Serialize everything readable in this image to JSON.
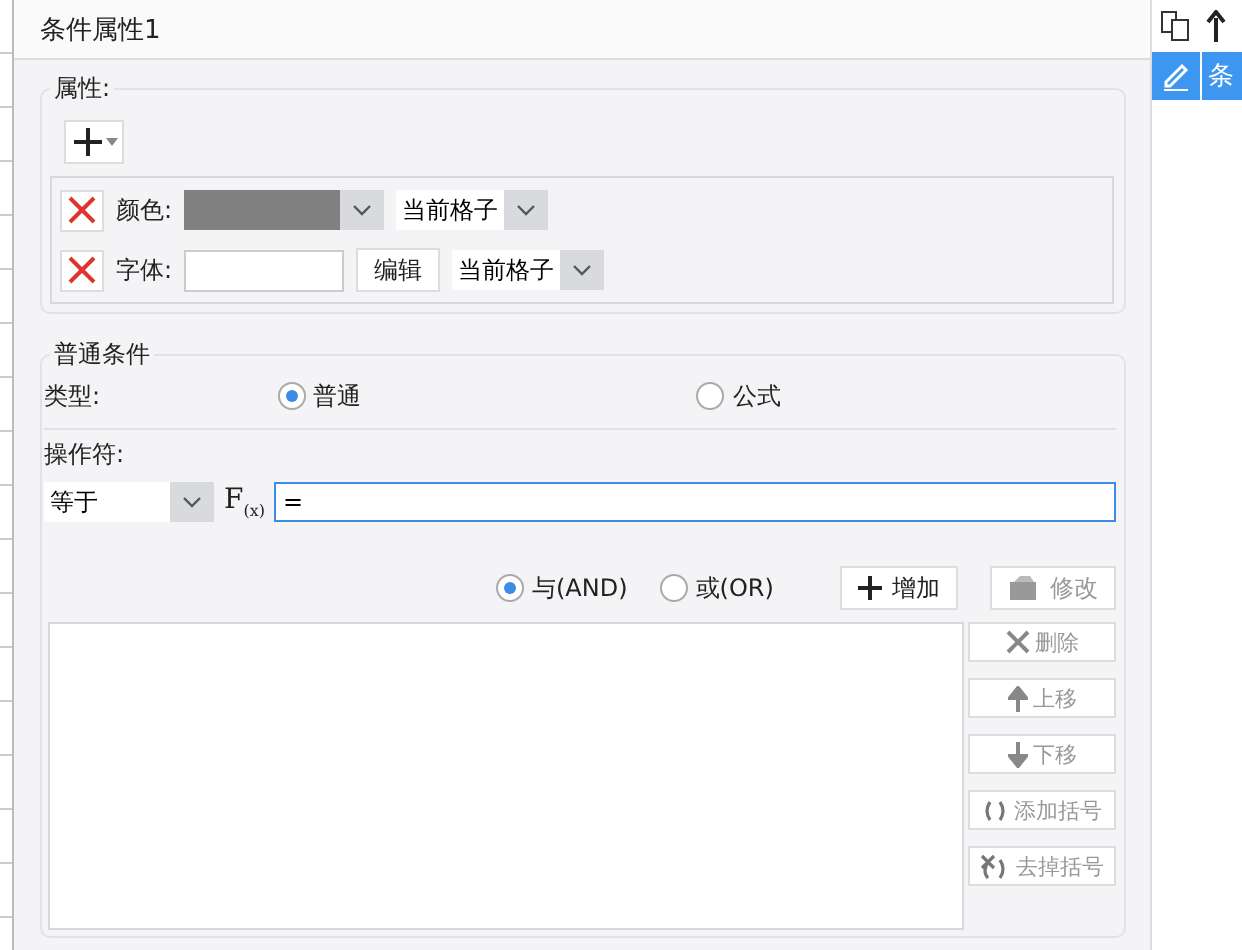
{
  "dialog": {
    "title": "条件属性1"
  },
  "attributes": {
    "legend": "属性:",
    "rows": [
      {
        "kind": "color",
        "label": "颜色:",
        "color": "#808080",
        "scope": "当前格子"
      },
      {
        "kind": "font",
        "label": "字体:",
        "edit_button": "编辑",
        "scope": "当前格子"
      }
    ]
  },
  "conditions": {
    "legend": "普通条件",
    "type_label": "类型:",
    "types": [
      {
        "label": "普通",
        "selected": true
      },
      {
        "label": "公式",
        "selected": false
      }
    ],
    "operator_label": "操作符:",
    "operator": "等于",
    "formula_button": "F$_{(x)}$",
    "formula_value": "=",
    "joins": [
      {
        "label": "与(AND)",
        "selected": true
      },
      {
        "label": "或(OR)",
        "selected": false
      }
    ],
    "add_button": {
      "label": "增加",
      "disabled": false
    },
    "modify_button": {
      "label": "修改",
      "disabled": true
    },
    "actions": [
      {
        "kind": "delete",
        "label": "删除",
        "disabled": true
      },
      {
        "kind": "up",
        "label": "上移",
        "disabled": true
      },
      {
        "kind": "down",
        "label": "下移",
        "disabled": true
      },
      {
        "kind": "add_brackets",
        "label": "添加括号",
        "disabled": true
      },
      {
        "kind": "remove_brackets",
        "label": "去掉括号",
        "disabled": true
      }
    ]
  },
  "side_panel": {
    "items": [
      {
        "label": "条",
        "selected": true
      }
    ]
  }
}
